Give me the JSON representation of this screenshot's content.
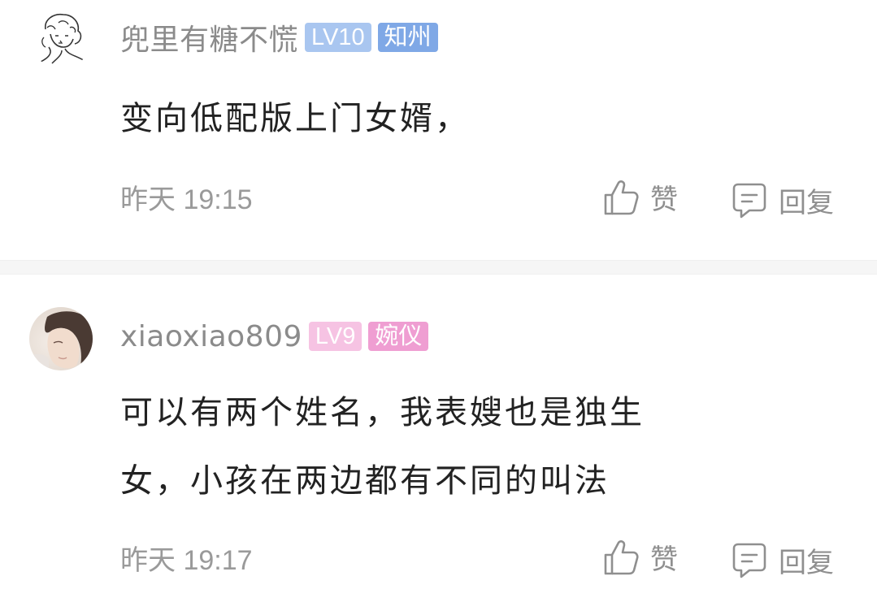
{
  "comments": [
    {
      "username": "兜里有糖不慌",
      "level": "LV10",
      "tag": "知州",
      "content_lines": [
        "变向低配版上门女婿，"
      ],
      "day": "昨天",
      "time": "19:15",
      "like_label": "赞",
      "reply_label": "回复",
      "avatar_icon": "sketch-portrait-icon",
      "level_color": "#a9c6f0",
      "tag_color": "#7fa8e6"
    },
    {
      "username": "xiaoxiao809",
      "level": "LV9",
      "tag": "婉仪",
      "content_lines": [
        "可以有两个姓名，我表嫂也是独生",
        "女，小孩在两边都有不同的叫法"
      ],
      "day": "昨天",
      "time": "19:17",
      "like_label": "赞",
      "reply_label": "回复",
      "avatar_icon": "photo-portrait-icon",
      "level_color": "#f6c3e3",
      "tag_color": "#ef9ed2"
    }
  ],
  "icons": {
    "like": "thumbs-up-icon",
    "reply": "comment-bubble-icon"
  }
}
